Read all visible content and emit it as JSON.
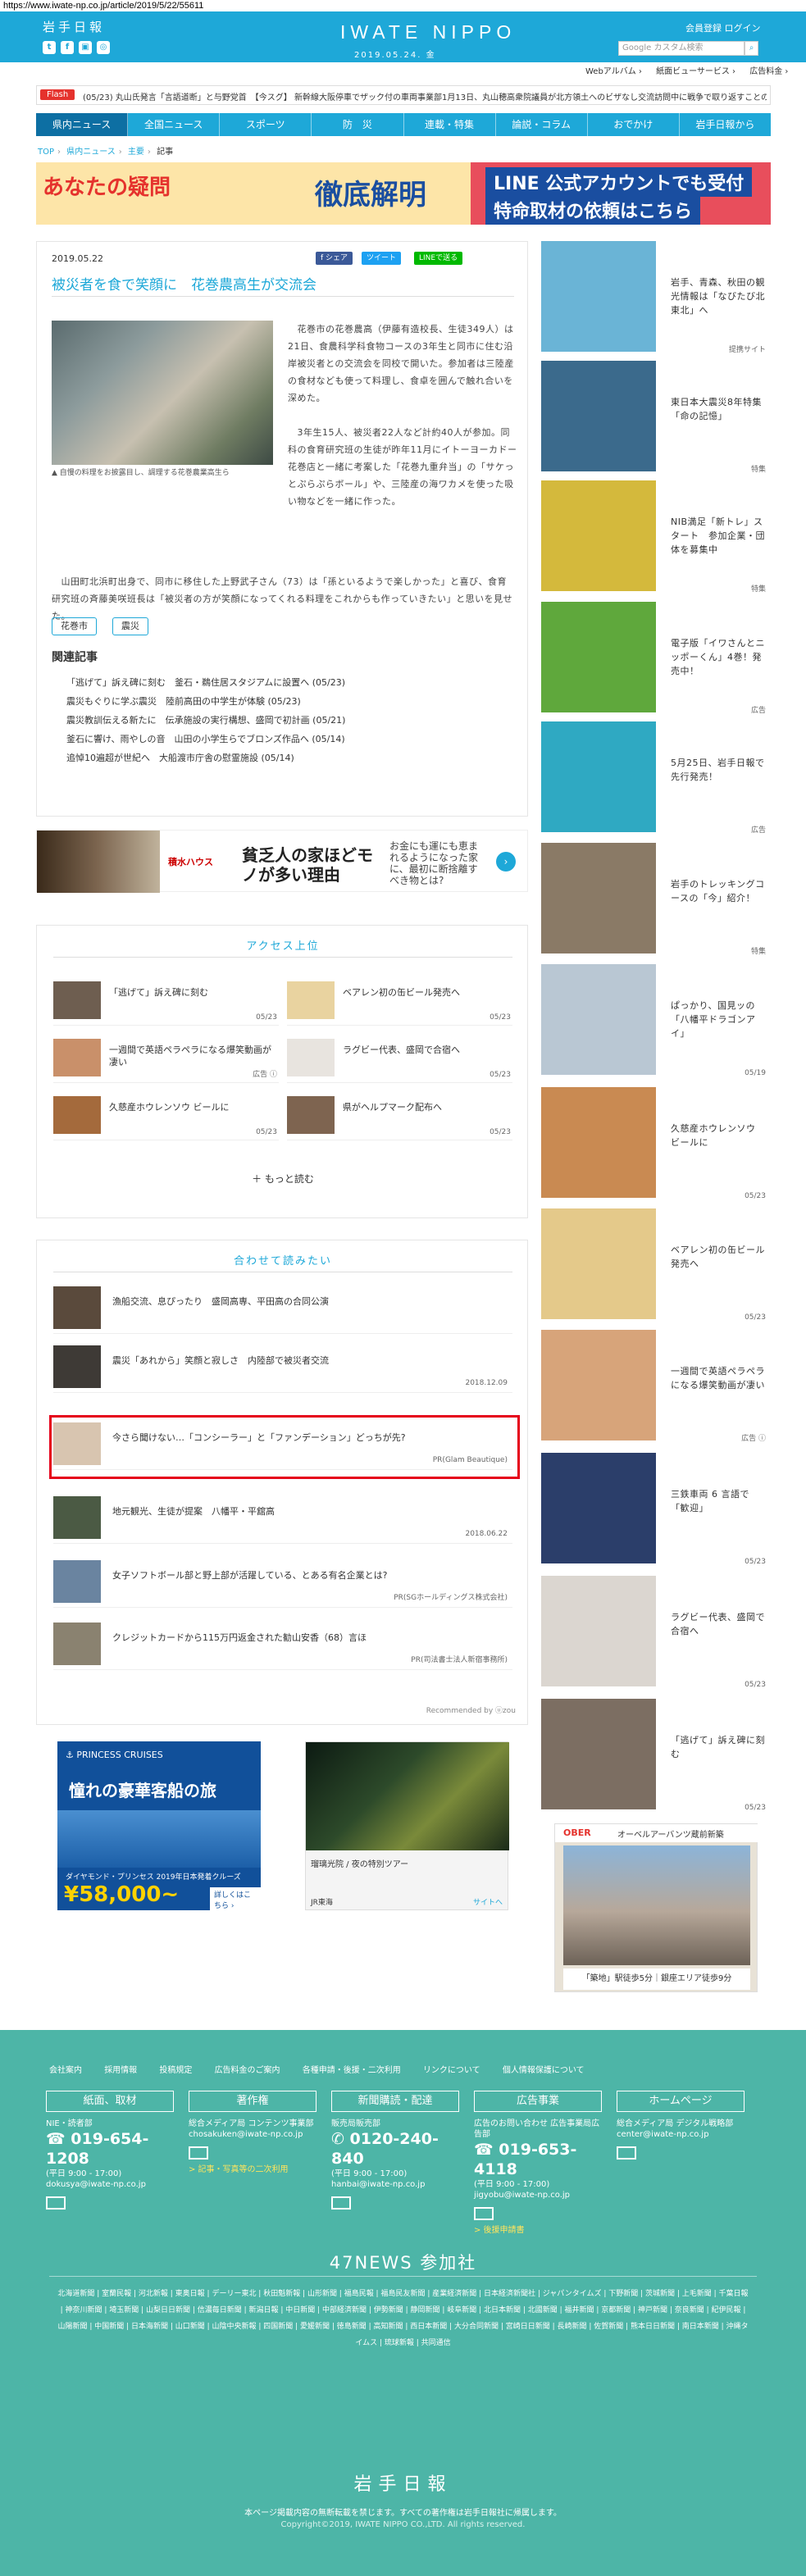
{
  "url": "https://www.iwate-np.co.jp/article/2019/5/22/55611",
  "header": {
    "logo_small": "岩手日報",
    "brand": "IWATE NIPPO",
    "date": "2019.05.24. 金",
    "member_links": "会員登録 ログイン",
    "search_placeholder": "Google カスタム検索",
    "sns": [
      "t",
      "f",
      "▣",
      "◎"
    ]
  },
  "subnav": [
    "Webアルバム ›",
    "紙面ビューサービス ›",
    "広告料金 ›"
  ],
  "flash": {
    "label": "Flash",
    "text": "(05/23) 丸山氏発言「言語道断」と与野党首　【今スグ】 新幹線大阪停車でザック付の車両事業部1月13日、丸山穂高衆院議員が北方領土へのビザなし交流訪問中に戦争で取り返すことの是非"
  },
  "mainnav": [
    "県内ニュース",
    "全国ニュース",
    "スポーツ",
    "防　災",
    "連載・特集",
    "論説・コラム",
    "おでかけ",
    "岩手日報から"
  ],
  "breadcrumb": [
    "TOP",
    "県内ニュース",
    "主要",
    "記事"
  ],
  "banner": {
    "left_a": "あなたの疑問",
    "left_b": "徹底解明",
    "right_a": "LINE 公式アカウントでも受付",
    "right_b": "特命取材の依頼はこちら"
  },
  "article": {
    "date": "2019.05.22",
    "share": [
      "f シェア",
      "ツイート",
      "LINEで送る"
    ],
    "title": "被災者を食で笑顔に　花巻農高生が交流会",
    "photo_caption": "▲ 自慢の料理をお披露目し、調理する花巻農業高生ら",
    "para1": "　花巻市の花巻農高（伊藤有造校長、生徒349人）は21日、食農科学科食物コースの3年生と同市に住む沿岸被災者との交流会を同校で開いた。参加者は三陸産の食材なども使って料理し、食卓を囲んで触れ合いを深めた。",
    "para2": "　3年生15人、被災者22人など計約40人が参加。同科の食育研究班の生徒が昨年11月にイトーヨーカドー花巻店と一緒に考案した「花巻九重弁当」の「サケっとぷらぷらボール」や、三陸産の海ワカメを使った吸い物などを一緒に作った。",
    "para3": "　山田町北浜町出身で、同市に移住した上野武子さん（73）は「孫といるようで楽しかった」と喜び、食育研究班の斉藤美咲班長は「被災者の方が笑顔になってくれる料理をこれからも作っていきたい」と思いを見せた。",
    "tags": [
      "花巻市",
      "震災"
    ],
    "related_heading": "関連記事",
    "related": [
      "「逃げて」訴え碑に刻む　釜石・鵜住居スタジアムに設置へ (05/23)",
      "震災もぐりに学ぶ震災　陸前高田の中学生が体験 (05/23)",
      "震災教訓伝える新たに　伝承施設の実行構想、盛岡で初計画 (05/21)",
      "釜石に響け、雨やしの音　山田の小学生らでブロンズ作品へ (05/14)",
      "追悼10遍超が世紀へ　大船渡市庁舎の慰霊施設 (05/14)"
    ]
  },
  "ad_strip": {
    "brand": "積水ハウス",
    "head": "貧乏人の家ほどモノが多い理由",
    "text": "お金にも運にも恵まれるようになった家に、最初に断捨離すべき物とは?",
    "arrow": "›"
  },
  "ranking": {
    "heading": "アクセス上位",
    "items": [
      {
        "text": "「逃げて」訴え碑に刻む",
        "date": "05/23"
      },
      {
        "text": "ベアレン初の缶ビール発売へ",
        "date": "05/23"
      },
      {
        "text": "一週間で英語ペラペラになる爆笑動画が凄い",
        "date": "広告 ⓘ"
      },
      {
        "text": "ラグビー代表、盛岡で合宿へ",
        "date": "05/23"
      },
      {
        "text": "久慈産ホウレンソウ ビールに",
        "date": "05/23"
      },
      {
        "text": "県がヘルプマーク配布へ",
        "date": "05/23"
      }
    ],
    "more": "＋ もっと読む"
  },
  "recommended": {
    "heading": "合わせて読みたい",
    "items": [
      {
        "text": "漁船交流、息ぴったり　盛岡高専、平田高の合同公演",
        "meta": ""
      },
      {
        "text": "震災「あれから」笑顔と寂しさ　内陸部で被災者交流",
        "meta": "2018.12.09"
      },
      {
        "text": "今さら聞けない…「コンシーラー」と「ファンデーション」どっちが先?",
        "meta": "PR(Glam Beautique)"
      },
      {
        "text": "地元観光、生徒が提案　八幡平・平舘高",
        "meta": "2018.06.22"
      },
      {
        "text": "女子ソフトボール部と野上部が活躍している、とある有名企業とは?",
        "meta": "PR(SGホールディングス株式会社)"
      },
      {
        "text": "クレジットカードから115万円返金された勧山安香（68）言ほ",
        "meta": "PR(司法書士法人新宿事務所)"
      }
    ],
    "powered": "Recommended by ⓤzou"
  },
  "ad_cruise": {
    "brand": "⚓ PRINCESS CRUISES",
    "title": "憧れの豪華客船の旅",
    "sub": "ダイヤモンド・プリンセス 2019年日本発着クルーズ",
    "price": "¥58,000~",
    "button": "詳しくはこちら ›"
  },
  "ad_garden": {
    "title": "瑠璃光院 / 夜の特別ツアー",
    "foot": "JR東海",
    "site": "サイトへ"
  },
  "sidebar": [
    {
      "text": "岩手、青森、秋田の観光情報は「なびたび北東北」へ",
      "meta": "提携サイト",
      "color": "#6ab4d6"
    },
    {
      "text": "東日本大震災8年特集「命の記憶」",
      "meta": "特集",
      "color": "#3b6a8c"
    },
    {
      "text": "NIB満足「新トレ」スタート　参加企業・団体を募集中",
      "meta": "特集",
      "color": "#d4b93c"
    },
    {
      "text": "電子版「イワさんとニッポーくん」4巻！発売中！",
      "meta": "広告",
      "color": "#5fa83c"
    },
    {
      "text": "5月25日、岩手日報で先行発売！",
      "meta": "広告",
      "color": "#2fa9c2"
    },
    {
      "text": "岩手のトレッキングコースの「今」紹介！",
      "meta": "特集",
      "color": "#8a7a66"
    },
    {
      "text": "ぱっかり、国見ッの「八幡平ドラゴンアイ」",
      "meta": "05/19",
      "color": "#b9c7d3"
    },
    {
      "text": "久慈産ホウレンソウ ビールに",
      "meta": "05/23",
      "color": "#c98a52"
    },
    {
      "text": "ベアレン初の缶ビール発売へ",
      "meta": "05/23",
      "color": "#e4c98a"
    },
    {
      "text": "一週間で英語ペラペラになる爆笑動画が凄い",
      "meta": "広告 ⓘ",
      "color": "#d7a47a"
    },
    {
      "text": "三鉄車両 6 言語で「歓迎」",
      "meta": "05/23",
      "color": "#2b3e6a"
    },
    {
      "text": "ラグビー代表、盛岡で合宿へ",
      "meta": "05/23",
      "color": "#dbd6d0"
    },
    {
      "text": "「逃げて」訴え碑に刻む",
      "meta": "05/23",
      "color": "#7c6e62"
    }
  ],
  "ad_side": {
    "brand": "OBER",
    "sub": "オーベルアーバンツ蔵前新築",
    "foot": "「築地」駅徒歩5分｜銀座エリア徒歩9分"
  },
  "footer": {
    "links": [
      "会社案内",
      "採用情報",
      "投稿規定",
      "広告料金のご案内",
      "各種申請・後援・二次利用",
      "リンクについて",
      "個人情報保護について"
    ],
    "cols": [
      {
        "head": "紙面、取材",
        "label": "NIE・読者部",
        "phone": "☎ 019-654-1208",
        "hours": "(平日 9:00 - 17:00)",
        "email": "dokusya@iwate-np.co.jp",
        "link": ""
      },
      {
        "head": "著作権",
        "label": "総合メディア局 コンテンツ事業部",
        "phone": "",
        "hours": "",
        "email": "chosakuken@iwate-np.co.jp",
        "link": "> 記事・写真等の二次利用"
      },
      {
        "head": "新聞購読・配達",
        "label": "販売局販売部",
        "phone": "✆ 0120-240-840",
        "hours": "(平日 9:00 - 17:00)",
        "email": "hanbai@iwate-np.co.jp",
        "link": ""
      },
      {
        "head": "広告事業",
        "label": "広告のお問い合わせ 広告事業局広告部",
        "phone": "☎ 019-653-4118",
        "hours": "(平日 9:00 - 17:00)",
        "email": "jigyobu@iwate-np.co.jp",
        "link": "> 後援申請書"
      },
      {
        "head": "ホームページ",
        "label": "総合メディア局 デジタル戦略部",
        "phone": "",
        "hours": "",
        "email": "center@iwate-np.co.jp",
        "link": ""
      }
    ],
    "news47": "47NEWS 参加社",
    "papers": "北海道新聞 | 室蘭民報 | 河北新報 | 東奥日報 | デーリー東北 | 秋田魁新報 | 山形新聞 | 福島民報 | 福島民友新聞 | 産業経済新聞 | 日本経済新聞社 | ジャパンタイムズ | 下野新聞 | 茨城新聞 | 上毛新聞 | 千葉日報 | 神奈川新聞 | 埼玉新聞 | 山梨日日新聞 | 信濃毎日新聞 | 新潟日報 | 中日新聞 | 中部経済新聞 | 伊勢新聞 | 静岡新聞 | 岐阜新聞 | 北日本新聞 | 北國新聞 | 福井新聞 | 京都新聞 | 神戸新聞 | 奈良新聞 | 紀伊民報 | 山陽新聞 | 中国新聞 | 日本海新聞 | 山口新聞 | 山陰中央新報 | 四国新聞 | 愛媛新聞 | 徳島新聞 | 高知新聞 | 西日本新聞 | 大分合同新聞 | 宮崎日日新聞 | 長崎新聞 | 佐賀新聞 | 熊本日日新聞 | 南日本新聞 | 沖縄タイムス | 琉球新報 | 共同通信",
    "logo": "岩手日報",
    "notice": "本ページ掲載内容の無断転載を禁じます。すべての著作権は岩手日報社に帰属します。",
    "copyright": "Copyright©2019, IWATE NIPPO CO.,LTD. All rights reserved."
  },
  "colors": {
    "brand": "#1ea8d8",
    "footer": "#4db5a7",
    "flash": "#e5322d",
    "highlight": "#e5001a"
  }
}
